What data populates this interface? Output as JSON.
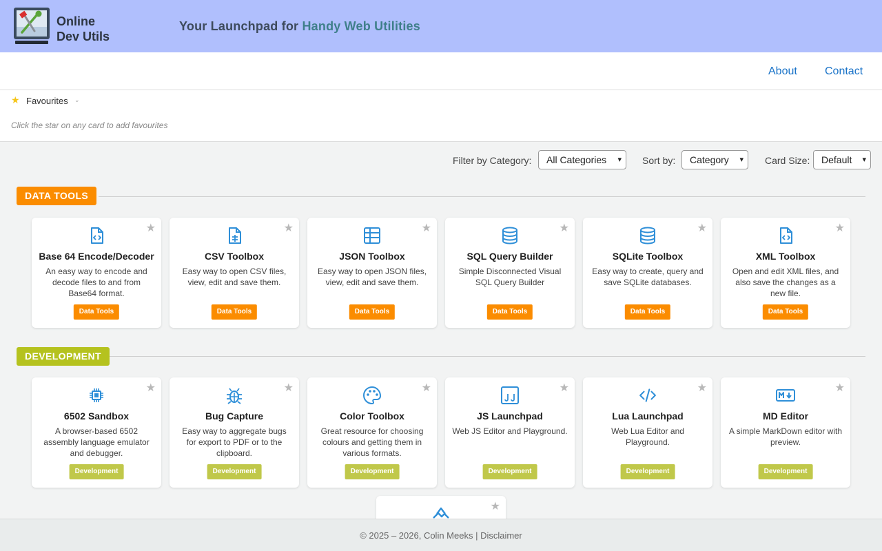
{
  "header": {
    "logo_line1": "Online",
    "logo_line2": "Dev Utils",
    "tagline_part1": "Your Launchpad for ",
    "tagline_part2": "Handy Web Utilities"
  },
  "nav": {
    "about": "About",
    "contact": "Contact"
  },
  "favourites": {
    "label": "Favourites",
    "hint": "Click the star on any card to add favourites"
  },
  "controls": {
    "filter_label": "Filter by Category:",
    "filter_value": "All Categories",
    "sort_label": "Sort by:",
    "sort_value": "Category",
    "size_label": "Card Size:",
    "size_value": "Default"
  },
  "categories": [
    {
      "name": "DATA TOOLS",
      "color": "#fb8c00",
      "cards": [
        {
          "title": "Base 64 Encode/Decoder",
          "desc": "An easy way to encode and decode files to and from Base64 format.",
          "badge": "Data Tools",
          "icon": "file-code-icon"
        },
        {
          "title": "CSV Toolbox",
          "desc": "Easy way to open CSV files, view, edit and save them.",
          "badge": "Data Tools",
          "icon": "file-csv-icon"
        },
        {
          "title": "JSON Toolbox",
          "desc": "Easy way to open JSON files, view, edit and save them.",
          "badge": "Data Tools",
          "icon": "table-icon"
        },
        {
          "title": "SQL Query Builder",
          "desc": "Simple Disconnected Visual SQL Query Builder",
          "badge": "Data Tools",
          "icon": "database-icon"
        },
        {
          "title": "SQLite Toolbox",
          "desc": "Easy way to create, query and save SQLite databases.",
          "badge": "Data Tools",
          "icon": "database-icon"
        },
        {
          "title": "XML Toolbox",
          "desc": "Open and edit XML files, and also save the changes as a new file.",
          "badge": "Data Tools",
          "icon": "file-code-icon"
        }
      ]
    },
    {
      "name": "DEVELOPMENT",
      "color": "#b5c21e",
      "badge_color": "#c0c84a",
      "cards": [
        {
          "title": "6502 Sandbox",
          "desc": "A browser-based 6502 assembly language emulator and debugger.",
          "badge": "Development",
          "icon": "cpu-icon"
        },
        {
          "title": "Bug Capture",
          "desc": "Easy way to aggregate bugs for export to PDF or to the clipboard.",
          "badge": "Development",
          "icon": "bug-icon"
        },
        {
          "title": "Color Toolbox",
          "desc": "Great resource for choosing colours and getting them in various formats.",
          "badge": "Development",
          "icon": "palette-icon"
        },
        {
          "title": "JS Launchpad",
          "desc": "Web JS Editor and Playground.",
          "badge": "Development",
          "icon": "js-icon"
        },
        {
          "title": "Lua Launchpad",
          "desc": "Web Lua Editor and Playground.",
          "badge": "Development",
          "icon": "code-icon"
        },
        {
          "title": "MD Editor",
          "desc": "A simple MarkDown editor with preview.",
          "badge": "Development",
          "icon": "markdown-icon"
        }
      ]
    }
  ],
  "footer": {
    "text": "© 2025 – 2026, Colin Meeks | Disclaimer"
  },
  "colors": {
    "header_bg": "#b0bffd",
    "link": "#1a73c8",
    "icon_blue": "#2f8fd8"
  }
}
